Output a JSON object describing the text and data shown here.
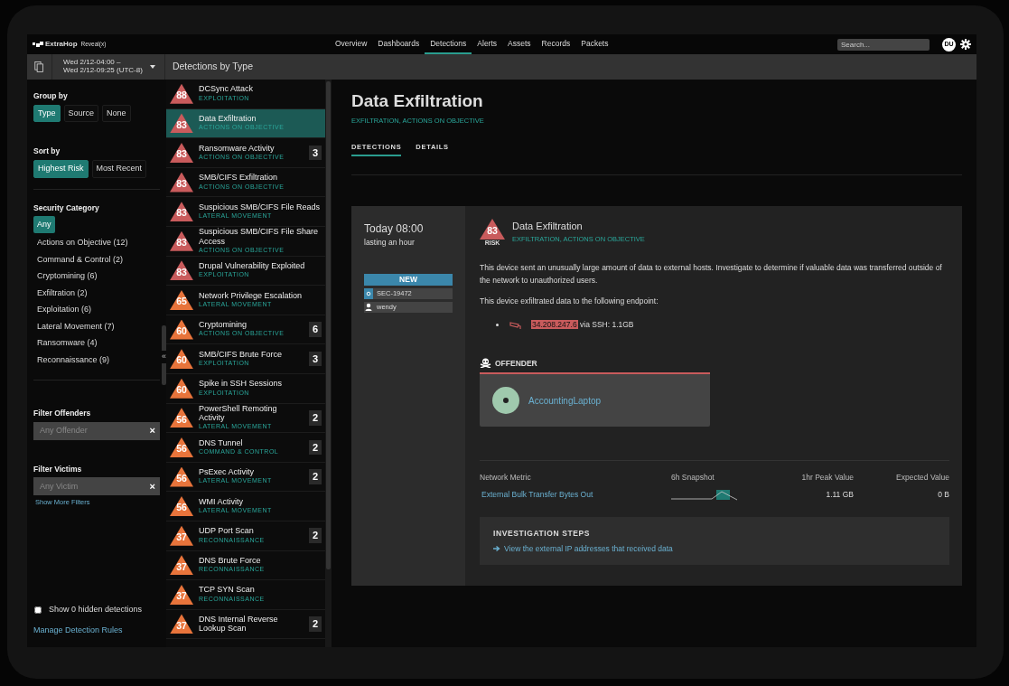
{
  "topbar": {
    "brand": "ExtraHop",
    "product": "Reveal(x)",
    "nav": [
      {
        "label": "Overview",
        "selected": false
      },
      {
        "label": "Dashboards",
        "selected": false
      },
      {
        "label": "Detections",
        "selected": true
      },
      {
        "label": "Alerts",
        "selected": false
      },
      {
        "label": "Assets",
        "selected": false
      },
      {
        "label": "Records",
        "selected": false
      },
      {
        "label": "Packets",
        "selected": false
      }
    ],
    "search": {
      "placeholder": "Search..."
    },
    "avatar": "DU"
  },
  "subbar": {
    "time_range": [
      "Wed 2/12-04:00 –",
      "Wed 2/12-09:25 (UTC-8)"
    ],
    "title": "Detections by Type"
  },
  "filters": {
    "group_by": {
      "label": "Group by",
      "options": [
        {
          "label": "Type",
          "selected": true
        },
        {
          "label": "Source",
          "selected": false
        },
        {
          "label": "None",
          "selected": false
        }
      ]
    },
    "sort_by": {
      "label": "Sort by",
      "options": [
        {
          "label": "Highest Risk",
          "selected": true
        },
        {
          "label": "Most Recent",
          "selected": false
        }
      ]
    },
    "security_category": {
      "label": "Security Category",
      "options": [
        {
          "label": "Any",
          "selected": true
        },
        {
          "label": "Actions on Objective (12)",
          "selected": false
        },
        {
          "label": "Command & Control (2)",
          "selected": false
        },
        {
          "label": "Cryptomining (6)",
          "selected": false
        },
        {
          "label": "Exfiltration (2)",
          "selected": false
        },
        {
          "label": "Exploitation (6)",
          "selected": false
        },
        {
          "label": "Lateral Movement (7)",
          "selected": false
        },
        {
          "label": "Ransomware (4)",
          "selected": false
        },
        {
          "label": "Reconnaissance (9)",
          "selected": false
        }
      ]
    },
    "collapse": "«",
    "offenders": {
      "label": "Filter Offenders",
      "placeholder": "Any Offender",
      "clear": "×"
    },
    "victims": {
      "label": "Filter Victims",
      "placeholder": "Any Victim",
      "clear": "×"
    },
    "more_filters": "Show More Filters",
    "show_hidden": {
      "label": "Show 0 hidden detections",
      "checked": false
    },
    "manage_rules": "Manage Detection Rules"
  },
  "detections": [
    {
      "risk": "88",
      "color": "#c95b5c",
      "name": "DCSync Attack",
      "category": "EXPLOITATION",
      "selected": false
    },
    {
      "risk": "83",
      "color": "#c95b5c",
      "name": "Data Exfiltration",
      "category": "ACTIONS ON OBJECTIVE",
      "selected": true
    },
    {
      "risk": "83",
      "color": "#c95b5c",
      "name": "Ransomware Activity",
      "category": "ACTIONS ON OBJECTIVE",
      "count": "3",
      "selected": false
    },
    {
      "risk": "83",
      "color": "#c95b5c",
      "name": "SMB/CIFS Exfiltration",
      "category": "ACTIONS ON OBJECTIVE",
      "selected": false
    },
    {
      "risk": "83",
      "color": "#c95b5c",
      "name": "Suspicious SMB/CIFS File Reads",
      "category": "LATERAL MOVEMENT",
      "selected": false
    },
    {
      "risk": "83",
      "color": "#c95b5c",
      "name": "Suspicious SMB/CIFS File Share Access",
      "category": "ACTIONS ON OBJECTIVE",
      "selected": false
    },
    {
      "risk": "83",
      "color": "#c95b5c",
      "name": "Drupal Vulnerability Exploited",
      "category": "EXPLOITATION",
      "selected": false
    },
    {
      "risk": "65",
      "color": "#e8743b",
      "name": "Network Privilege Escalation",
      "category": "LATERAL MOVEMENT",
      "selected": false
    },
    {
      "risk": "60",
      "color": "#e8743b",
      "name": "Cryptomining",
      "category": "ACTIONS ON OBJECTIVE",
      "count": "6",
      "selected": false
    },
    {
      "risk": "60",
      "color": "#e8743b",
      "name": "SMB/CIFS Brute Force",
      "category": "EXPLOITATION",
      "count": "3",
      "selected": false
    },
    {
      "risk": "60",
      "color": "#e8743b",
      "name": "Spike in SSH Sessions",
      "category": "EXPLOITATION",
      "selected": false
    },
    {
      "risk": "56",
      "color": "#e8743b",
      "name": "PowerShell Remoting Activity",
      "category": "LATERAL MOVEMENT",
      "count": "2",
      "selected": false
    },
    {
      "risk": "56",
      "color": "#e8743b",
      "name": "DNS Tunnel",
      "category": "COMMAND & CONTROL",
      "count": "2",
      "selected": false
    },
    {
      "risk": "56",
      "color": "#e8743b",
      "name": "PsExec Activity",
      "category": "LATERAL MOVEMENT",
      "count": "2",
      "selected": false
    },
    {
      "risk": "56",
      "color": "#e8743b",
      "name": "WMI Activity",
      "category": "LATERAL MOVEMENT",
      "selected": false
    },
    {
      "risk": "37",
      "color": "#e8743b",
      "name": "UDP Port Scan",
      "category": "RECONNAISSANCE",
      "count": "2",
      "selected": false
    },
    {
      "risk": "37",
      "color": "#e8743b",
      "name": "DNS Brute Force",
      "category": "RECONNAISSANCE",
      "selected": false
    },
    {
      "risk": "37",
      "color": "#e8743b",
      "name": "TCP SYN Scan",
      "category": "RECONNAISSANCE",
      "selected": false
    },
    {
      "risk": "37",
      "color": "#e8743b",
      "name": "DNS Internal Reverse Lookup Scan",
      "count": "2",
      "selected": false
    }
  ],
  "detail": {
    "title": "Data Exfiltration",
    "categories": "EXFILTRATION, ACTIONS ON OBJECTIVE",
    "tabs": [
      {
        "label": "DETECTIONS",
        "selected": true
      },
      {
        "label": "DETAILS",
        "selected": false
      }
    ],
    "card": {
      "time": "Today 08:00",
      "duration": "lasting an hour",
      "status": "NEW",
      "ticket": "SEC-19472",
      "assignee": "wendy",
      "risk": "83",
      "risk_label": "RISK",
      "title": "Data Exfiltration",
      "categories": "EXFILTRATION, ACTIONS ON OBJECTIVE",
      "description": "This device sent an unusually large amount of data to external hosts. Investigate to determine if valuable data was transferred outside of the network to unauthorized users.",
      "endpoint_intro": "This device exfiltrated data to the following endpoint:",
      "endpoint_ip": "34.208.247.6",
      "endpoint_detail": "via SSH: 1.1GB",
      "offender_label": "OFFENDER",
      "offender": "AccountingLaptop",
      "metrics": {
        "columns": [
          "Network Metric",
          "6h Snapshot",
          "1hr Peak Value",
          "Expected Value"
        ],
        "rows": [
          {
            "metric": "External Bulk Transfer Bytes Out",
            "peak": "1.11 GB",
            "expected": "0 B"
          }
        ]
      },
      "steps": {
        "title": "INVESTIGATION STEPS",
        "items": [
          "View the external IP addresses that received data"
        ]
      }
    }
  }
}
